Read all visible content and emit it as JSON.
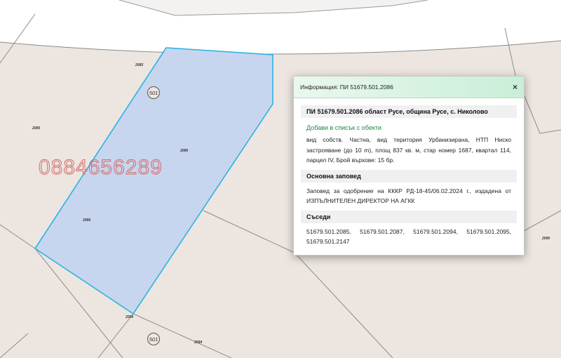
{
  "map": {
    "background_color": "#ede6e0",
    "parcel_fill": "#c7d6ee",
    "parcel_stroke": "#29b3e8",
    "labels": {
      "top": "2085",
      "left": "2085",
      "center": "2086",
      "lower": "2086",
      "bottom": "2095",
      "right": "2090",
      "bottom_right": "2094"
    },
    "badges": [
      "501",
      "501"
    ]
  },
  "watermark": "0884656289",
  "popup": {
    "title": "Информация: ПИ 51679.501.2086",
    "close_icon": "×",
    "heading": "ПИ 51679.501.2086 област Русе, община Русе, с. Николово",
    "add_link": "Добави в списък с обекти",
    "description": "вид собств. Частна, вид територия Урбанизирана, НТП Ниско застрояване (до 10 m), площ 837 кв. м, стар номер 1687, квартал 114, парцел IV, Брой върхове: 15 бр.",
    "order_heading": "Основна заповед",
    "order_text": "Заповед за одобрение на КККР РД-18-45/06.02.2024 г., издадена от ИЗПЪЛНИТЕЛЕН ДИРЕКТОР НА АГКК",
    "neighbors_heading": "Съседи",
    "neighbors": [
      "51679.501.2085,",
      "51679.501.2087,",
      "51679.501.2094,",
      "51679.501.2095,",
      "51679.501.2147"
    ]
  }
}
